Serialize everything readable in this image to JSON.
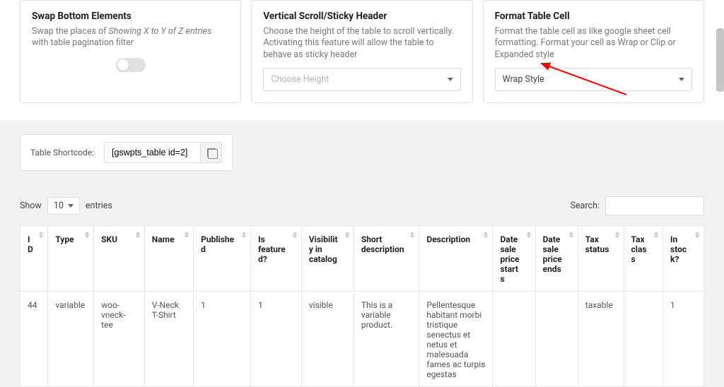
{
  "cards": {
    "swap": {
      "title": "Swap Bottom Elements",
      "desc_pre": "Swap the places of ",
      "desc_em": "Showing X to Y of Z entries",
      "desc_post": " with table pagination filter"
    },
    "scroll": {
      "title": "Vertical Scroll/Sticky Header",
      "desc": "Choose the height of the table to scroll vertically. Activating this feature will allow the table to behave as sticky header",
      "select_label": "Choose Height"
    },
    "format": {
      "title": "Format Table Cell",
      "desc": "Format the table cell as like google sheet cell formatting. Format your cell as Wrap or Clip or Expanded style",
      "select_label": "Wrap Style"
    }
  },
  "shortcode": {
    "label": "Table Shortcode:",
    "value": "[gswpts_table id=2]"
  },
  "controls": {
    "show": "Show",
    "entries": "entries",
    "per_page": "10",
    "search": "Search:"
  },
  "columns": [
    "ID",
    "Type",
    "SKU",
    "Name",
    "Published",
    "Is featured?",
    "Visibility in catalog",
    "Short description",
    "Description",
    "Date sale price starts",
    "Date sale price ends",
    "Tax status",
    "Tax class",
    "In stock?"
  ],
  "rows": [
    {
      "id": "44",
      "type": "variable",
      "sku": "woo-vneck-tee",
      "name": "V-Neck T-Shirt",
      "published": "1",
      "featured": "1",
      "visibility": "visible",
      "short": "This is a variable product.",
      "description": "Pellentesque habitant morbi tristique senectus et netus et malesuada fames ac turpis egestas",
      "dsps": "",
      "dspe": "",
      "taxstatus": "taxable",
      "taxclass": "",
      "stock": "1"
    }
  ]
}
